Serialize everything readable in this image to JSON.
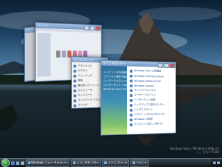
{
  "desktop": {
    "watermark": "Windows Vista (TM) Beta 2 評価コピー。ビルド 5384"
  },
  "windows": {
    "paint_title": "ペイント",
    "gallery_title": "Windows フォト ギャラリー",
    "explorer_title": "エクスプローラ",
    "welcome_title": "ようこそセンター",
    "explorer_items": [
      "ドキュメント",
      "ピクチャ",
      "ミュージック",
      "検索",
      "最近使ったファイル",
      "コンピュータ",
      "ネットワーク",
      "コントロール パネル",
      "プリンタ",
      "ヘルプとサポート"
    ],
    "welcome_sidebar": [
      "コンピュータの詳細を表示",
      "ファイルと設定の転送",
      "ユーザーアカウントの追加",
      "インターネットへの接続",
      "Windows Vista のデモ"
    ],
    "welcome_items": [
      "Windows Vista の新機能",
      "Windows Ultimate Extras",
      "Windows Media Center",
      "Windows Update",
      "コントロール パネル",
      "ユーザー アカウント",
      "インターネット接続",
      "バックアップと復元センター",
      "ヘルプとサポート",
      "デスクトップのカスタマイズ",
      "Windows の登録",
      "オンラインで詳しく調べる",
      "ネットワーク センター"
    ]
  },
  "taskbar": {
    "tasks": [
      "Windows フォト ギャラリー",
      "ようこそセンター",
      "エクスプローラ",
      "ペイント"
    ],
    "tray_icons": [
      "network-icon",
      "volume-icon"
    ],
    "swatch_colors": [
      "#8a8a8a",
      "#a0a0c8",
      "#c86464",
      "#e07090",
      "#d0a0c0",
      "#b070b0"
    ]
  }
}
